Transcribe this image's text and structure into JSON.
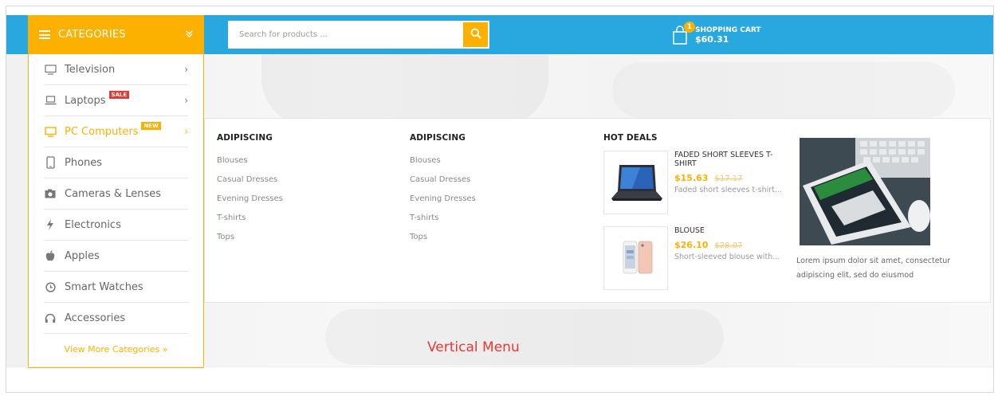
{
  "header": {
    "categories_label": "CATEGORIES",
    "search_placeholder": "Search for products ...",
    "cart": {
      "count": "1",
      "label": "SHOPPING CART",
      "total": "$60.31"
    }
  },
  "vertical_menu": {
    "items": [
      {
        "label": "Television",
        "icon": "television-icon"
      },
      {
        "label": "Laptops",
        "icon": "laptop-icon",
        "badge": "SALE"
      },
      {
        "label": "PC Computers",
        "icon": "monitor-icon",
        "badge": "NEW",
        "active": true
      },
      {
        "label": "Phones",
        "icon": "phone-icon"
      },
      {
        "label": "Cameras & Lenses",
        "icon": "camera-icon"
      },
      {
        "label": "Electronics",
        "icon": "bolt-icon"
      },
      {
        "label": "Apples",
        "icon": "apple-icon"
      },
      {
        "label": "Smart Watches",
        "icon": "clock-icon"
      },
      {
        "label": "Accessories",
        "icon": "headphones-icon"
      }
    ],
    "view_more": "View More Categories »"
  },
  "mega_menu": {
    "columns": [
      {
        "title": "ADIPISCING",
        "links": [
          "Blouses",
          "Casual Dresses",
          "Evening Dresses",
          "T-shirts",
          "Tops"
        ]
      },
      {
        "title": "ADIPISCING",
        "links": [
          "Blouses",
          "Casual Dresses",
          "Evening Dresses",
          "T-shirts",
          "Tops"
        ]
      }
    ],
    "hot_deals": {
      "title": "HOT DEALS",
      "products": [
        {
          "name": "FADED SHORT SLEEVES T-SHIRT",
          "price": "$15.63",
          "old_price": "$17.17",
          "desc": "Faded short sleeves t-shirt..."
        },
        {
          "name": "BLOUSE",
          "price": "$26.10",
          "old_price": "$28.07",
          "desc": "Short-sleeved blouse with..."
        }
      ]
    },
    "promo_text": "Lorem ipsum dolor sit amet, consectetur adipiscing elit, sed do eiusmod"
  },
  "caption": "Vertical Menu",
  "colors": {
    "accent": "#fcb101",
    "topbar": "#29a8e0",
    "sale": "#e53935",
    "caption": "#e53935"
  }
}
